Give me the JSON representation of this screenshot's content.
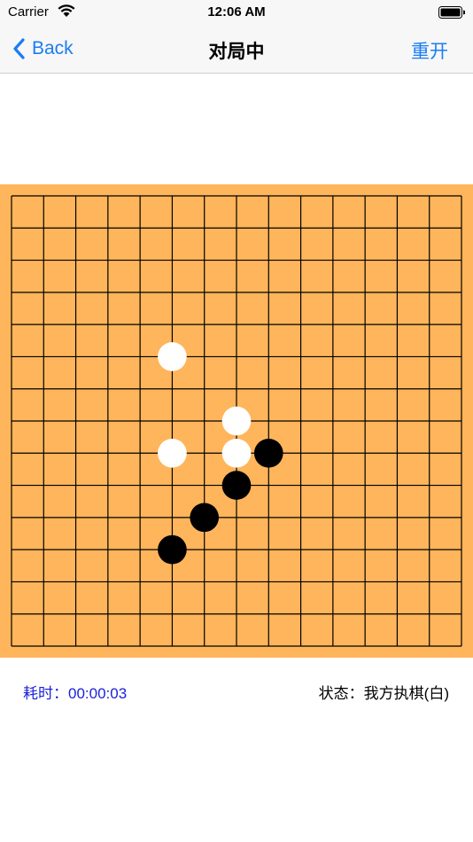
{
  "status_bar": {
    "carrier": "Carrier",
    "time": "12:06 AM",
    "wifi_icon": "wifi-icon",
    "battery_icon": "battery-icon"
  },
  "nav": {
    "back_label": "Back",
    "back_icon": "chevron-left-icon",
    "title": "对局中",
    "restart_label": "重开"
  },
  "board": {
    "lines": 15,
    "board_color": "#ffb55b",
    "line_color": "#000000",
    "stones": [
      {
        "color": "white",
        "col": 5,
        "row": 5
      },
      {
        "color": "white",
        "col": 7,
        "row": 7
      },
      {
        "color": "white",
        "col": 5,
        "row": 8
      },
      {
        "color": "white",
        "col": 7,
        "row": 8
      },
      {
        "color": "black",
        "col": 8,
        "row": 8
      },
      {
        "color": "black",
        "col": 7,
        "row": 9
      },
      {
        "color": "black",
        "col": 6,
        "row": 10
      },
      {
        "color": "black",
        "col": 5,
        "row": 11
      }
    ]
  },
  "footer": {
    "elapsed_time": "耗时：00:00:03",
    "status": "状态：我方执棋(白)"
  },
  "colors": {
    "accent": "#1a7cf5",
    "timer_text": "#1c22d8"
  }
}
